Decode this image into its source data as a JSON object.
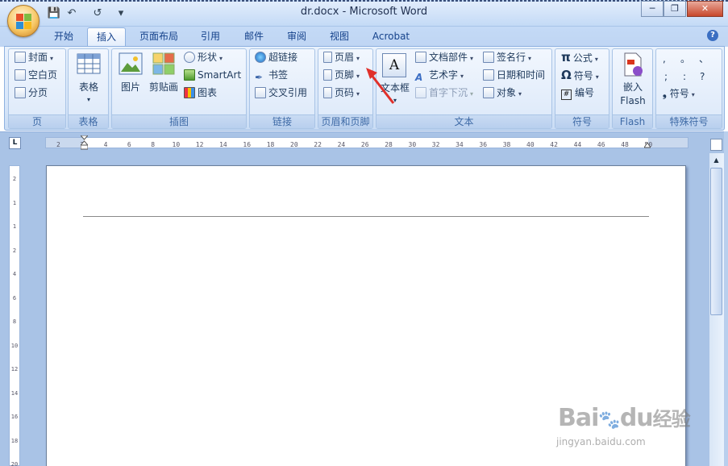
{
  "window": {
    "title": "dr.docx - Microsoft Word",
    "minimize": "─",
    "restore": "❐",
    "close": "✕"
  },
  "qat": {
    "save": "💾",
    "undo": "↶",
    "redo": "↺",
    "customize": "▾"
  },
  "tabs": [
    "开始",
    "插入",
    "页面布局",
    "引用",
    "邮件",
    "审阅",
    "视图",
    "Acrobat"
  ],
  "active_tab": "插入",
  "help": "?",
  "groups": {
    "page": {
      "label": "页",
      "items": [
        {
          "label": "封面"
        },
        {
          "label": "空白页"
        },
        {
          "label": "分页"
        }
      ]
    },
    "table": {
      "label": "表格",
      "button": "表格"
    },
    "illustrations": {
      "label": "插图",
      "picture": "图片",
      "clipart": "剪贴画",
      "items": [
        {
          "label": "形状"
        },
        {
          "label": "SmartArt"
        },
        {
          "label": "图表"
        }
      ]
    },
    "links": {
      "label": "链接",
      "items": [
        {
          "label": "超链接"
        },
        {
          "label": "书签"
        },
        {
          "label": "交叉引用"
        }
      ]
    },
    "header_footer": {
      "label": "页眉和页脚",
      "items": [
        {
          "label": "页眉"
        },
        {
          "label": "页脚"
        },
        {
          "label": "页码"
        }
      ]
    },
    "text": {
      "label": "文本",
      "textbox": "文本框",
      "textbox_icon_letter": "A",
      "col1": [
        {
          "label": "文档部件"
        },
        {
          "label": "艺术字"
        },
        {
          "label": "首字下沉"
        }
      ],
      "col2": [
        {
          "label": "签名行"
        },
        {
          "label": "日期和时间"
        },
        {
          "label": "对象"
        }
      ]
    },
    "symbols": {
      "label": "符号",
      "items": [
        {
          "label": "公式"
        },
        {
          "label": "符号"
        },
        {
          "label": "编号"
        }
      ],
      "glyphs": [
        "π",
        "Ω",
        "#"
      ]
    },
    "flash": {
      "label": "Flash",
      "button_line1": "嵌入",
      "button_line2": "Flash"
    },
    "special": {
      "label": "特殊符号",
      "glyphs": [
        ",",
        "。",
        "、",
        ";",
        ":",
        "?"
      ],
      "button": "符号",
      "button_glyph": "❟"
    }
  },
  "ruler": {
    "corner": "L",
    "h_ticks": [
      "2",
      "2",
      "4",
      "6",
      "8",
      "10",
      "12",
      "14",
      "16",
      "18",
      "20",
      "22",
      "24",
      "26",
      "28",
      "30",
      "32",
      "34",
      "36",
      "38",
      "40",
      "42",
      "44",
      "46",
      "48",
      "50"
    ],
    "v_ticks": [
      "2",
      "1",
      "1",
      "2",
      "4",
      "6",
      "8",
      "10",
      "12",
      "14",
      "16",
      "18",
      "20"
    ]
  },
  "watermark": {
    "brand": "Bai",
    "brand_du": "du",
    "brand_cn": "经验",
    "url": "jingyan.baidu.com"
  },
  "colors": {
    "accent": "#15428b",
    "ribbon_bg": "#d7e6f9",
    "arrow": "#e0302a"
  }
}
